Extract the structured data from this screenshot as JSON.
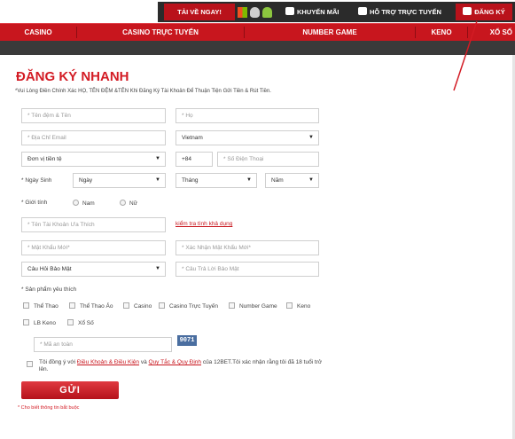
{
  "topbar": {
    "download_label": "TẢI VỀ NGAY!",
    "promotions_label": "KHUYẾN MÃI",
    "support_label": "HỖ TRỢ TRỰC TUYẾN",
    "register_label": "ĐĂNG KÝ",
    "icons": [
      "windows-icon",
      "apple-icon",
      "android-icon"
    ]
  },
  "nav": {
    "items": [
      "CASINO",
      "CASINO TRỰC TUYẾN",
      "NUMBER GAME",
      "KENO",
      "XỔ SỐ"
    ]
  },
  "form": {
    "title": "ĐĂNG KÝ NHANH",
    "subtitle": "*Vui Lòng Điền Chính Xác HỌ, TÊN ĐỆM &TÊN Khi Đăng Ký Tài Khoản Để Thuận Tiện Gửi Tiền & Rút Tiền.",
    "name_placeholder": "* Tên đệm & Tên",
    "surname_placeholder": "* Họ",
    "email_placeholder": "* Địa Chỉ Email",
    "country_value": "Vietnam",
    "currency_value": "Đơn vị tiền tệ",
    "phone_prefix": "+84",
    "phone_placeholder": "* Số Điện Thoại",
    "dob_label": "* Ngày Sinh",
    "day_value": "Ngày",
    "month_value": "Tháng",
    "year_value": "Năm",
    "gender_label": "* Giới tính",
    "gender_male": "Nam",
    "gender_female": "Nữ",
    "username_placeholder": "* Tên Tài Khoản Ưa Thích",
    "check_availability_link": "kiểm tra tình khả dụng",
    "password_placeholder": "* Mật Khẩu Mới*",
    "confirm_password_placeholder": "* Xác Nhận Mật Khẩu Mới*",
    "security_question_value": "Câu Hỏi Bảo Mật",
    "security_answer_placeholder": "* Câu Trả Lời Bảo Mật",
    "products_label": "* Sản phẩm yêu thích",
    "products": [
      "Thể Thao",
      "Thể Thao Ảo",
      "Casino",
      "Casino Trực Tuyến",
      "Number Game",
      "Keno",
      "LB Keno",
      "Xổ Số"
    ],
    "captcha_placeholder": "* Mã an toàn",
    "captcha_code": "9071",
    "agree_prefix": "Tôi đồng ý với ",
    "agree_terms": "Điều Khoản & Điều Kiện",
    "agree_and": " và ",
    "agree_rules": "Quy Tắc & Quy Định",
    "agree_suffix": " của 12BET.Tôi xác nhận rằng tôi đã 18 tuổi trở lên.",
    "submit_label": "GỬI",
    "required_note": "* Cho biết thông tin bắt buộc"
  },
  "colors": {
    "brand_red": "#c8161e",
    "dark_bar": "#2b2b2b"
  }
}
